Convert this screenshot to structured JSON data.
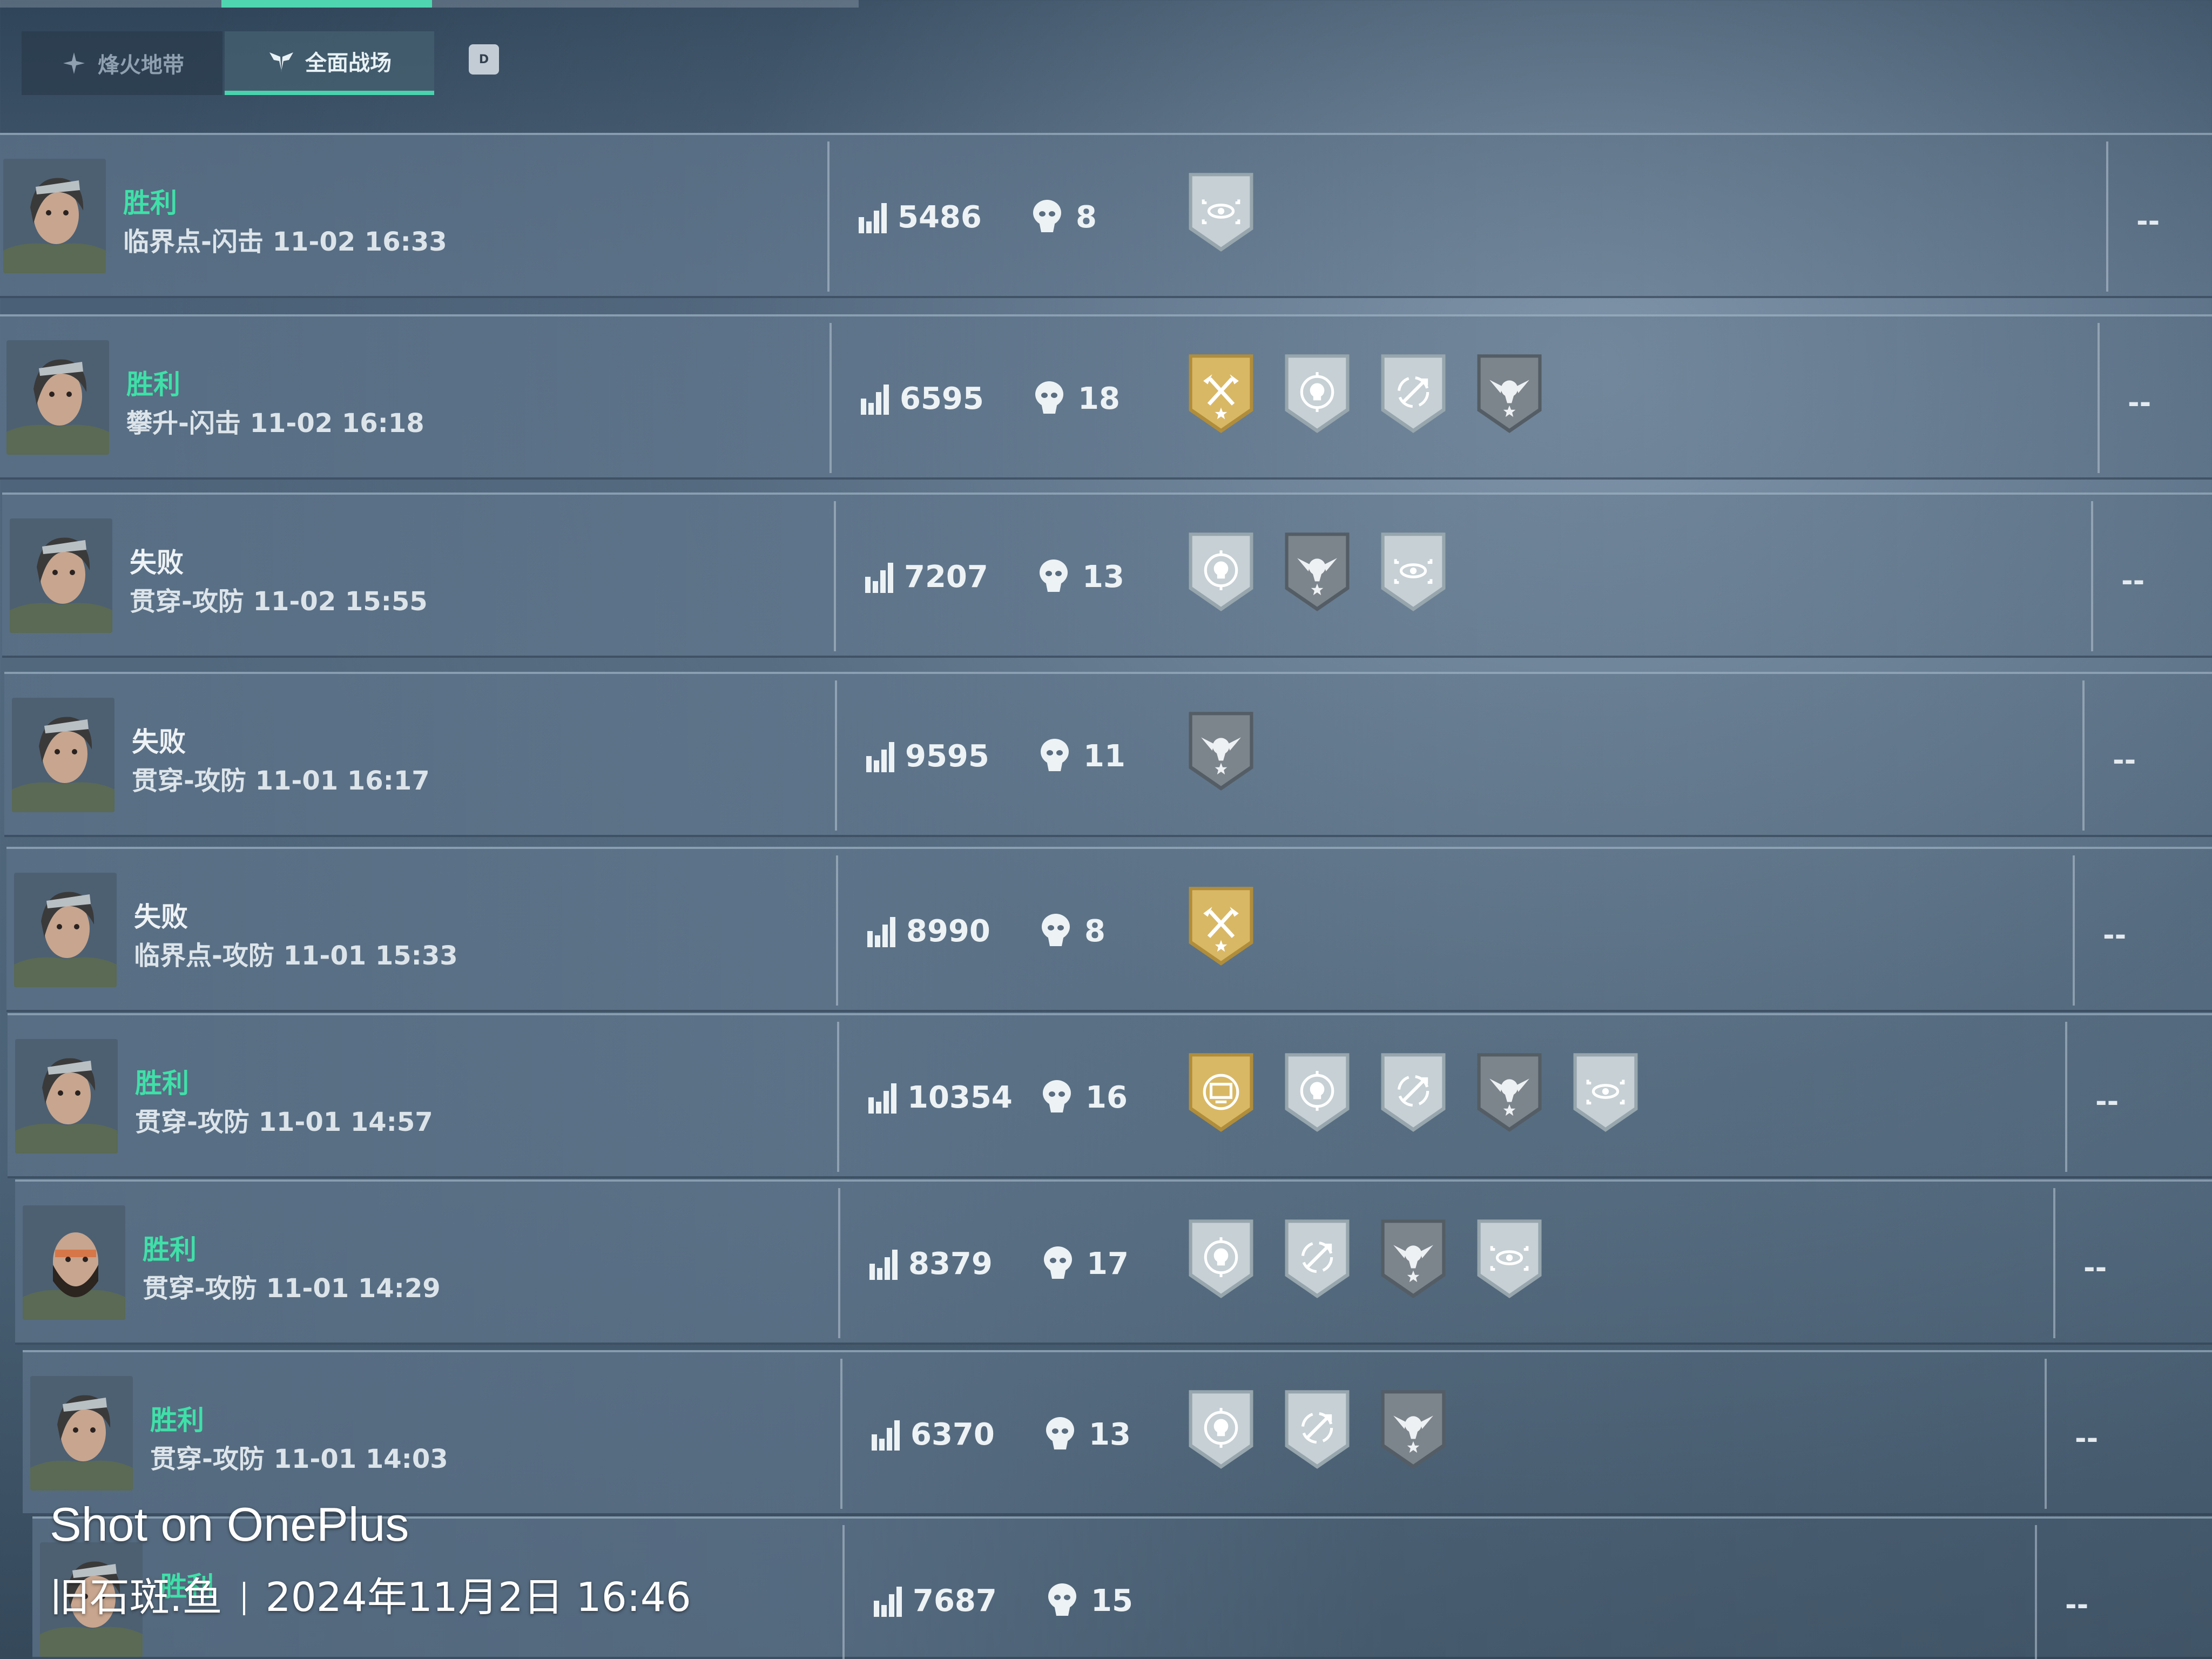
{
  "tabs": [
    {
      "label": "烽火地带",
      "icon": "sparkle-icon",
      "active": false
    },
    {
      "label": "全面战场",
      "icon": "winged-emblem-icon",
      "active": true
    }
  ],
  "badge": "D",
  "colors": {
    "accent": "#48d3ad",
    "win": "#3fe0a8",
    "lose": "#eef2f5",
    "gold_medal": "#c9a650",
    "silver_medal": "#b4c0c6",
    "dark_medal": "#6f7880"
  },
  "matches": [
    {
      "result": "胜利",
      "outcome": "win",
      "info": "临界点-闪击 11-02 16:33",
      "score": "5486",
      "kills": "8",
      "medals": [
        "eye-target-silver-medal"
      ],
      "extra": "--"
    },
    {
      "result": "胜利",
      "outcome": "win",
      "info": "攀升-闪击 11-02 16:18",
      "score": "6595",
      "kills": "18",
      "medals": [
        "crossed-axes-gold-medal",
        "skull-target-silver-medal",
        "crosshair-ring-silver-medal",
        "winged-skull-dark-medal"
      ],
      "extra": "--"
    },
    {
      "result": "失败",
      "outcome": "lose",
      "info": "贯穿-攻防 11-02 15:55",
      "score": "7207",
      "kills": "13",
      "medals": [
        "skull-target-silver-medal",
        "winged-skull-dark-medal",
        "eye-target-silver-medal"
      ],
      "extra": "--"
    },
    {
      "result": "失败",
      "outcome": "lose",
      "info": "贯穿-攻防 11-01 16:17",
      "score": "9595",
      "kills": "11",
      "medals": [
        "winged-skull-dark-medal"
      ],
      "extra": "--"
    },
    {
      "result": "失败",
      "outcome": "lose",
      "info": "临界点-攻防 11-01 15:33",
      "score": "8990",
      "kills": "8",
      "medals": [
        "crossed-axes-gold-medal"
      ],
      "extra": "--"
    },
    {
      "result": "胜利",
      "outcome": "win",
      "info": "贯穿-攻防 11-01 14:57",
      "score": "10354",
      "kills": "16",
      "medals": [
        "screen-gold-medal",
        "skull-target-silver-medal",
        "crosshair-ring-silver-medal",
        "winged-skull-dark-medal",
        "eye-target-silver-medal"
      ],
      "extra": "--"
    },
    {
      "result": "胜利",
      "outcome": "win",
      "info": "贯穿-攻防 11-01 14:29",
      "score": "8379",
      "kills": "17",
      "medals": [
        "skull-target-silver-medal",
        "crosshair-ring-silver-medal",
        "winged-skull-dark-medal",
        "eye-target-silver-medal"
      ],
      "extra": "--"
    },
    {
      "result": "胜利",
      "outcome": "win",
      "info": "贯穿-攻防 11-01 14:03",
      "score": "6370",
      "kills": "13",
      "medals": [
        "skull-target-silver-medal",
        "crosshair-ring-silver-medal",
        "winged-skull-dark-medal"
      ],
      "extra": "--"
    },
    {
      "result": "胜利",
      "outcome": "win",
      "info": "",
      "score": "7687",
      "kills": "15",
      "medals": [],
      "extra": "--"
    }
  ],
  "watermark": {
    "title": "Shot on OnePlus",
    "author": "旧石斑.鱼",
    "datetime": "2024年11月2日 16:46"
  }
}
